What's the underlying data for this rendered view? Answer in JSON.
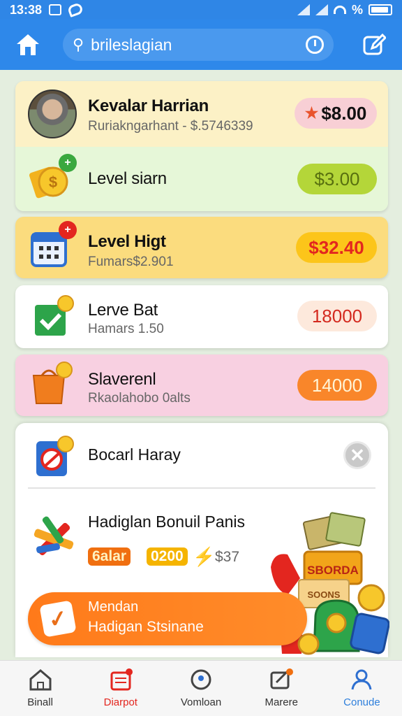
{
  "status_bar": {
    "time": "13:38",
    "battery_symbol": "%"
  },
  "header": {
    "search_text": "brileslagian"
  },
  "cards": [
    {
      "title": "Kevalar Harrian",
      "subtitle": "Ruriakngarhant - $.5746339",
      "amount": "$8.00",
      "amount_icon": "star-icon",
      "bg": "#fcf1c6",
      "pill_bg": "#f8cfd5",
      "pill_color": "#111"
    },
    {
      "title": "Level siarn",
      "amount": "$3.00",
      "bg": "#e6f7d8",
      "pill_bg": "#b4d639",
      "pill_color": "#58700f"
    },
    {
      "title": "Level Higt",
      "subtitle": "Fumars$2.901",
      "amount": "$32.40",
      "bg": "#fbdc7e",
      "pill_bg": "#fcc51a",
      "pill_color": "#e3261f"
    },
    {
      "title": "Lerve Bat",
      "subtitle": "Hamars 1.50",
      "amount": "18000",
      "bg": "#ffffff",
      "pill_bg": "#fde9dc",
      "pill_color": "#d42a1f"
    },
    {
      "title": "Slaverenl",
      "subtitle": "Rkaolahobo 0alts",
      "amount": "14000",
      "bg": "#f8d0e1",
      "pill_bg": "#f9862a",
      "pill_color": "#fff4d6"
    }
  ],
  "popup": {
    "title": "Bocarl Haray",
    "bonus_title": "Hadiglan Bonuil Panis",
    "tag1": "6alar",
    "tag2": "0200",
    "amount": "$37",
    "cta_line1": "Mendan",
    "cta_line2": "Hadigan Stsinane",
    "art_label": "SBORDA",
    "art_box_label": "SOONS"
  },
  "tabs": [
    {
      "label": "Binall",
      "color": "#333333"
    },
    {
      "label": "Diarpot",
      "color": "#e3261f"
    },
    {
      "label": "Vomloan",
      "color": "#333333"
    },
    {
      "label": "Marere",
      "color": "#333333"
    },
    {
      "label": "Conude",
      "color": "#2e7fdc"
    }
  ]
}
